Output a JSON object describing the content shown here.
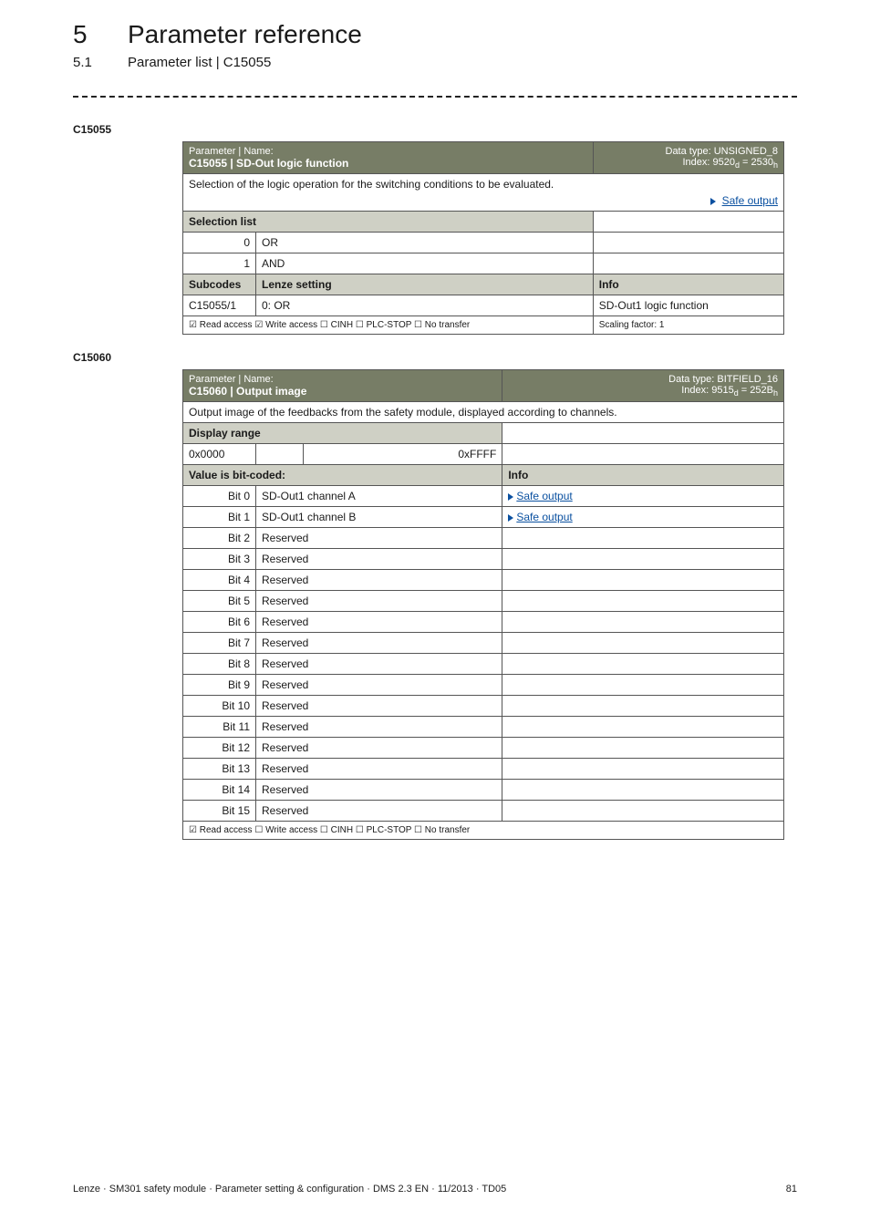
{
  "header": {
    "section_number": "5",
    "section_title": "Parameter reference",
    "subsection_number": "5.1",
    "subsection_title": "Parameter list | C15055"
  },
  "param_labels": {
    "c15055": "C15055",
    "c15060": "C15060"
  },
  "t1": {
    "hdr_left_line1": "Parameter | Name:",
    "hdr_left_line2": "C15055 | SD-Out logic function",
    "hdr_right_line1": "Data type: UNSIGNED_8",
    "hdr_right_line2_prefix": "Index: 9520",
    "hdr_right_line2_mid": " = 2530",
    "desc": "Selection of the logic operation for the switching conditions to be evaluated.",
    "link_text": "Safe output",
    "selection_list_label": "Selection list",
    "rows": [
      {
        "n": "0",
        "v": "OR"
      },
      {
        "n": "1",
        "v": "AND"
      }
    ],
    "subcodes_label": "Subcodes",
    "lenze_label": "Lenze setting",
    "info_label": "Info",
    "sub_row": {
      "code": "C15055/1",
      "setting": "0: OR",
      "info": "SD-Out1 logic function"
    },
    "foot_flags": "☑ Read access  ☑ Write access  ☐ CINH  ☐ PLC-STOP  ☐ No transfer",
    "foot_scaling": "Scaling factor: 1"
  },
  "t2": {
    "hdr_left_line1": "Parameter | Name:",
    "hdr_left_line2": "C15060 | Output image",
    "hdr_right_line1": "Data type: BITFIELD_16",
    "hdr_right_line2_prefix": "Index: 9515",
    "hdr_right_line2_mid": " = 252B",
    "desc": "Output image of the feedbacks from the safety module, displayed according to channels.",
    "display_range_label": "Display range",
    "dr_left": "0x0000",
    "dr_right": "0xFFFF",
    "bitcoded_label": "Value is bit-coded:",
    "info_label": "Info",
    "link_text": "Safe output",
    "bits": [
      {
        "b": "Bit 0",
        "v": "SD-Out1 channel A",
        "link": true
      },
      {
        "b": "Bit 1",
        "v": "SD-Out1 channel B",
        "link": true
      },
      {
        "b": "Bit 2",
        "v": "Reserved",
        "link": false
      },
      {
        "b": "Bit 3",
        "v": "Reserved",
        "link": false
      },
      {
        "b": "Bit 4",
        "v": "Reserved",
        "link": false
      },
      {
        "b": "Bit 5",
        "v": "Reserved",
        "link": false
      },
      {
        "b": "Bit 6",
        "v": "Reserved",
        "link": false
      },
      {
        "b": "Bit 7",
        "v": "Reserved",
        "link": false
      },
      {
        "b": "Bit 8",
        "v": "Reserved",
        "link": false
      },
      {
        "b": "Bit 9",
        "v": "Reserved",
        "link": false
      },
      {
        "b": "Bit 10",
        "v": "Reserved",
        "link": false
      },
      {
        "b": "Bit 11",
        "v": "Reserved",
        "link": false
      },
      {
        "b": "Bit 12",
        "v": "Reserved",
        "link": false
      },
      {
        "b": "Bit 13",
        "v": "Reserved",
        "link": false
      },
      {
        "b": "Bit 14",
        "v": "Reserved",
        "link": false
      },
      {
        "b": "Bit 15",
        "v": "Reserved",
        "link": false
      }
    ],
    "foot_flags": "☑ Read access  ☐ Write access  ☐ CINH  ☐ PLC-STOP  ☐ No transfer"
  },
  "footer": {
    "left": "Lenze · SM301 safety module · Parameter setting & configuration · DMS 2.3 EN · 11/2013 · TD05",
    "right": "81"
  }
}
